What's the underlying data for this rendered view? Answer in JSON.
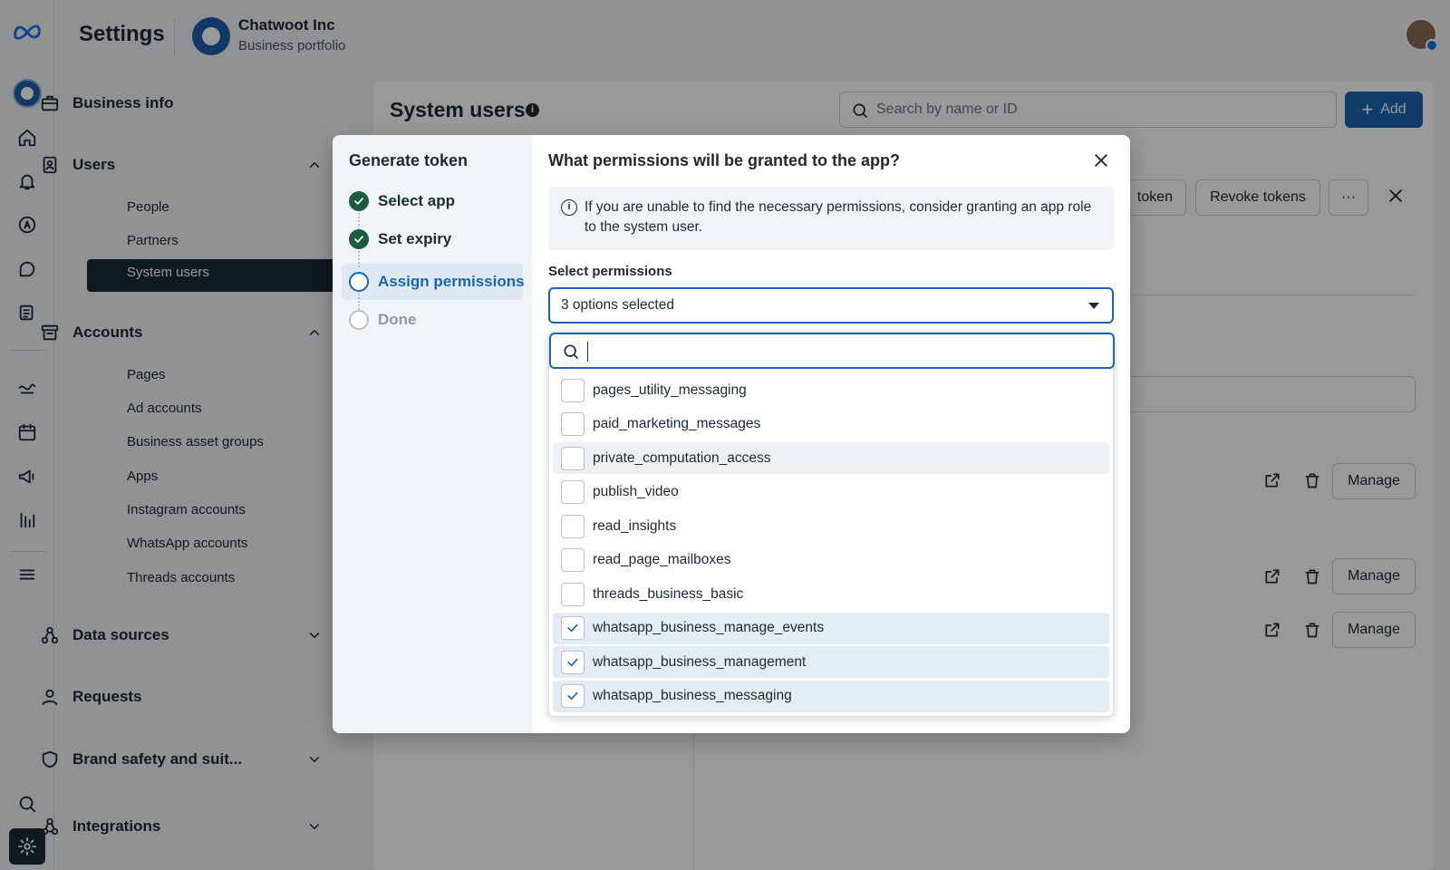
{
  "header": {
    "title": "Settings",
    "business_name": "Chatwoot Inc",
    "business_sub": "Business portfolio"
  },
  "nav": {
    "business_info": "Business info",
    "users": "Users",
    "users_items": [
      "People",
      "Partners",
      "System users"
    ],
    "accounts": "Accounts",
    "accounts_items": [
      "Pages",
      "Ad accounts",
      "Business asset groups",
      "Apps",
      "Instagram accounts",
      "WhatsApp accounts",
      "Threads accounts"
    ],
    "data_sources": "Data sources",
    "requests": "Requests",
    "brand_safety": "Brand safety and suit...",
    "integrations": "Integrations"
  },
  "main": {
    "title": "System users",
    "search_placeholder": "Search by name or ID",
    "add_label": "Add",
    "token_btn": "token",
    "revoke_btn": "Revoke tokens",
    "more_btn": "···",
    "manage_label": "Manage"
  },
  "modal": {
    "left_title": "Generate token",
    "steps": [
      "Select app",
      "Set expiry",
      "Assign permissions",
      "Done"
    ],
    "title": "What permissions will be granted to the app?",
    "info_text": "If you are unable to find the necessary permissions, consider granting an app role to the system user.",
    "select_label": "Select permissions",
    "select_value": "3 options selected",
    "options": [
      {
        "label": "pages_utility_messaging",
        "checked": false
      },
      {
        "label": "paid_marketing_messages",
        "checked": false
      },
      {
        "label": "private_computation_access",
        "checked": false
      },
      {
        "label": "publish_video",
        "checked": false
      },
      {
        "label": "read_insights",
        "checked": false
      },
      {
        "label": "read_page_mailboxes",
        "checked": false
      },
      {
        "label": "threads_business_basic",
        "checked": false
      },
      {
        "label": "whatsapp_business_manage_events",
        "checked": true
      },
      {
        "label": "whatsapp_business_management",
        "checked": true
      },
      {
        "label": "whatsapp_business_messaging",
        "checked": true
      }
    ]
  }
}
